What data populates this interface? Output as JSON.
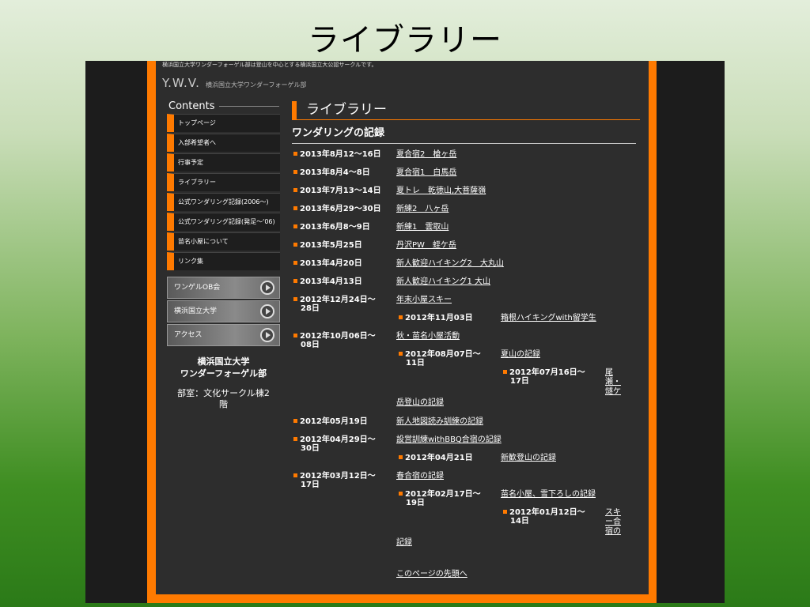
{
  "slide_title": "ライブラリー",
  "site": {
    "tagline": "横浜国立大学ワンダーフォーゲル部は登山を中心とする横浜国立大公認サークルです。",
    "logo": "Y.W.V.",
    "logo_sub": "横浜国立大学ワンダーフォーゲル部"
  },
  "sidebar": {
    "contents_label": "Contents",
    "items": [
      {
        "label": "トップページ"
      },
      {
        "label": "入部希望者へ"
      },
      {
        "label": "行事予定"
      },
      {
        "label": "ライブラリー"
      },
      {
        "label": "公式ワンダリング記録(2006～)"
      },
      {
        "label": "公式ワンダリング記録(発足～'06)"
      },
      {
        "label": "苗名小屋について"
      },
      {
        "label": "リンク集"
      }
    ],
    "banners": [
      {
        "label": "ワンゲルOB会"
      },
      {
        "label": "横浜国立大学"
      },
      {
        "label": "アクセス"
      }
    ],
    "org_line1": "横浜国立大学",
    "org_line2": "ワンダーフォーゲル部",
    "room_line1": "部室：文化サークル棟2",
    "room_line2": "階"
  },
  "main": {
    "page_title": "ライブラリー",
    "section_title": "ワンダリングの記録",
    "records": [
      {
        "date": "2013年8月12～16日",
        "title": "夏合宿2　槍ヶ岳"
      },
      {
        "date": "2013年8月4～8日",
        "title": "夏合宿1　白馬岳"
      },
      {
        "date": "2013年7月13～14日",
        "title": "夏トレ　乾徳山,大菩薩嶺"
      },
      {
        "date": "2013年6月29～30日",
        "title": "新練2　八ヶ岳"
      },
      {
        "date": "2013年6月8～9日",
        "title": "新練1　雲取山"
      },
      {
        "date": "2013年5月25日",
        "title": "丹沢PW　蛭ケ岳"
      },
      {
        "date": "2013年4月20日",
        "title": "新人歓迎ハイキング2　大丸山"
      },
      {
        "date": "2013年4月13日",
        "title": "新人歓迎ハイキング1 大山"
      },
      {
        "date": "2012年12月24日～28日",
        "title": "年末小屋スキー"
      },
      {
        "date": "2012年11月03日",
        "title": "箱根ハイキングwith留学生"
      },
      {
        "date": "2012年10月06日～08日",
        "title": "秋・苗名小屋活動"
      },
      {
        "date": "2012年08月07日～11日",
        "title": "夏山の記録"
      },
      {
        "date": "2012年07月16日～17日",
        "title": "尾瀬・燧ケ岳登山の記録"
      },
      {
        "date": "2012年05月19日",
        "title": "新人地図読み訓練の記録"
      },
      {
        "date": "2012年04月29日～30日",
        "title": "設営訓練withBBQ合宿の記録"
      },
      {
        "date": "2012年04月21日",
        "title": "新歓登山の記録"
      },
      {
        "date": "2012年03月12日～17日",
        "title": "春合宿の記録"
      },
      {
        "date": "2012年02月17日～19日",
        "title": "苗名小屋、雪下ろしの記録"
      },
      {
        "date": "2012年01月12日～14日",
        "title": "スキー合宿の記録"
      }
    ],
    "split": {
      "r12_a": "尾",
      "r12_b": "瀬・",
      "r12_c": "燧ケ",
      "r12_d": "岳登山の記録",
      "r18_a": "スキ",
      "r18_b": "ー合",
      "r18_c": "宿の",
      "r18_d": "記録",
      "d8_a": "2012年12月24日～",
      "d8_b": "28日",
      "d10_a": "2012年10月06日～",
      "d10_b": "08日",
      "d11_a": "2012年08月07日～",
      "d11_b": "11日",
      "d12_a": "2012年07月16日～",
      "d12_b": "17日",
      "d14_a": "2012年04月29日～",
      "d14_b": "30日",
      "d16_a": "2012年03月12日～",
      "d16_b": "17日",
      "d17_a": "2012年02月17日～",
      "d17_b": "19日",
      "d18_a": "2012年01月12日～",
      "d18_b": "14日"
    },
    "top_link": "このページの先頭へ"
  },
  "colors": {
    "accent": "#ff7a00",
    "panel": "#2d2d2d",
    "outer": "#1c1c1c"
  }
}
